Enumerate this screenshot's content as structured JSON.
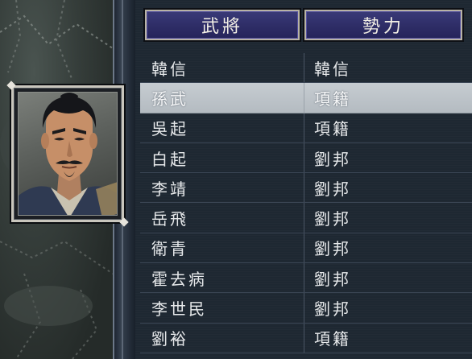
{
  "headers": {
    "general": "武將",
    "faction": "勢力"
  },
  "selected_index": 1,
  "rows": [
    {
      "general": "韓信",
      "faction": "韓信"
    },
    {
      "general": "孫武",
      "faction": "項籍"
    },
    {
      "general": "吳起",
      "faction": "項籍"
    },
    {
      "general": "白起",
      "faction": "劉邦"
    },
    {
      "general": "李靖",
      "faction": "劉邦"
    },
    {
      "general": "岳飛",
      "faction": "劉邦"
    },
    {
      "general": "衛青",
      "faction": "劉邦"
    },
    {
      "general": "霍去病",
      "faction": "劉邦"
    },
    {
      "general": "李世民",
      "faction": "劉邦"
    },
    {
      "general": "劉裕",
      "faction": "項籍"
    }
  ],
  "colors": {
    "header_bg": "#2e2d66",
    "selected_row": "#b4bbc1",
    "panel_bg": "#1e2832"
  },
  "portrait_icon": "general-portrait"
}
